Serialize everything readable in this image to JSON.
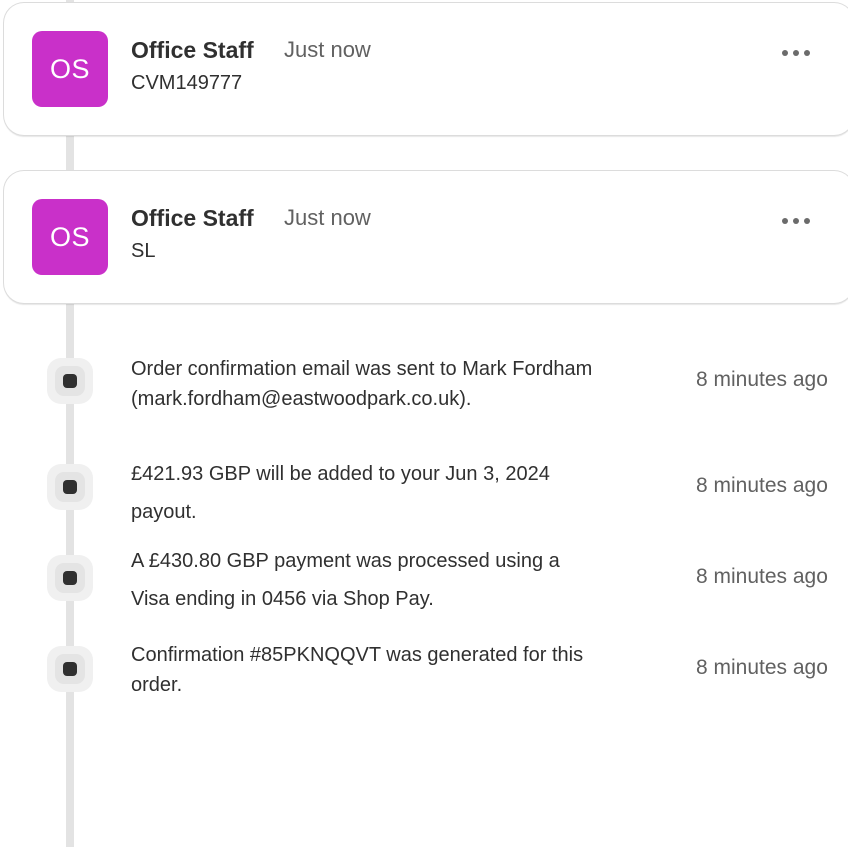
{
  "comments": [
    {
      "avatar_initials": "OS",
      "author": "Office Staff",
      "time": "Just now",
      "message": "CVM149777",
      "avatar_color": "#c930c9"
    },
    {
      "avatar_initials": "OS",
      "author": "Office Staff",
      "time": "Just now",
      "message": "SL",
      "avatar_color": "#c930c9"
    }
  ],
  "events": [
    {
      "line1": "Order confirmation email was sent to Mark Fordham",
      "line2": "(mark.fordham@eastwoodpark.co.uk).",
      "time": "8 minutes ago"
    },
    {
      "line1": "£421.93 GBP will be added to your Jun 3, 2024",
      "line2": "payout.",
      "time": "8 minutes ago"
    },
    {
      "line1": "A £430.80 GBP payment was processed using a",
      "line2": "Visa ending in 0456 via Shop Pay.",
      "time": "8 minutes ago"
    },
    {
      "line1": "Confirmation #85PKNQQVT was generated for this",
      "line2": "order.",
      "time": "8 minutes ago"
    }
  ],
  "icons": {
    "more": "more-horizontal-icon",
    "event_marker": "timeline-dot-icon"
  }
}
